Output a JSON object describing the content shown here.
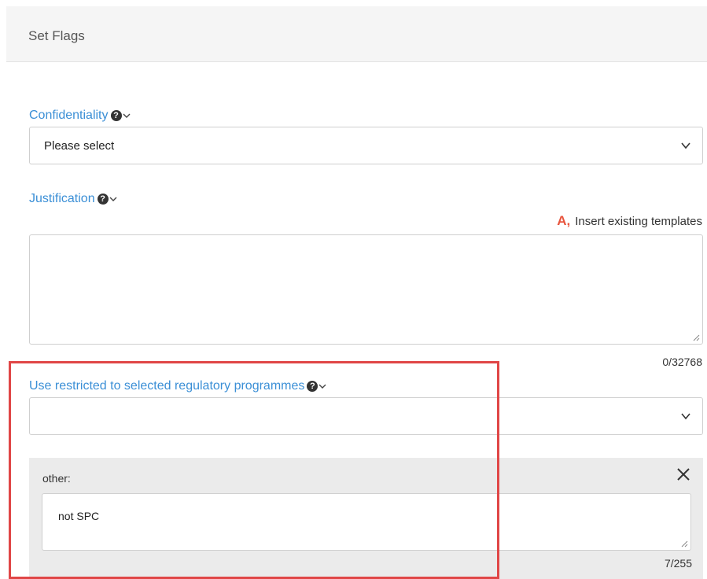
{
  "header": {
    "title": "Set Flags"
  },
  "confidentiality": {
    "label": "Confidentiality",
    "selected": "Please select"
  },
  "justification": {
    "label": "Justification",
    "template_link": "Insert existing templates",
    "value": "",
    "counter": "0/32768"
  },
  "regulatory": {
    "label": "Use restricted to selected regulatory programmes",
    "selected": ""
  },
  "other": {
    "label": "other:",
    "value": "not SPC",
    "counter": "7/255"
  },
  "colors": {
    "label_blue": "#3b8fd6",
    "template_icon": "#e8553e",
    "highlight_red": "#e04646"
  }
}
